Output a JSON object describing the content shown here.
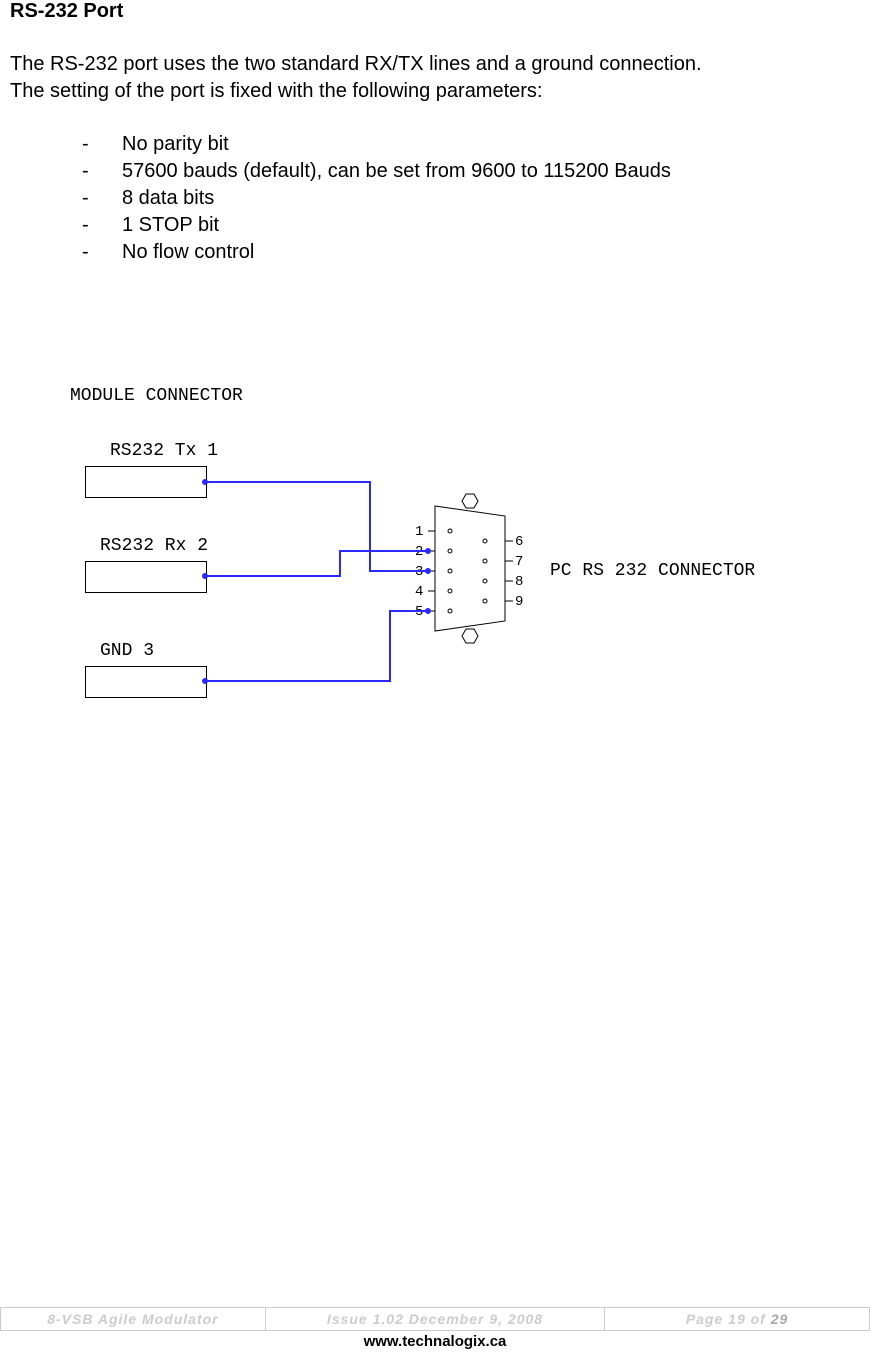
{
  "heading": "RS-232 Port",
  "para1": "The RS-232 port uses the two standard RX/TX lines and a ground connection.",
  "para2": "The setting of the port is fixed with the following parameters:",
  "bullets": [
    "No parity bit",
    "57600 bauds (default), can be set from 9600 to 115200 Bauds",
    "8 data bits",
    "1 STOP bit",
    "No flow control"
  ],
  "diagram": {
    "module_connector": "MODULE CONNECTOR",
    "tx": "RS232 Tx 1",
    "rx": "RS232 Rx 2",
    "gnd": "GND 3",
    "pc_label": "PC RS 232 CONNECTOR",
    "pins_left": [
      "1",
      "2",
      "3",
      "4",
      "5"
    ],
    "pins_right": [
      "6",
      "7",
      "8",
      "9"
    ]
  },
  "footer": {
    "left": "8-VSB Agile Modulator",
    "mid": "Issue 1.02   December 9, 2008",
    "right_prefix": "Page 19 of ",
    "right_total": "29",
    "url": "www.technalogix.ca"
  }
}
